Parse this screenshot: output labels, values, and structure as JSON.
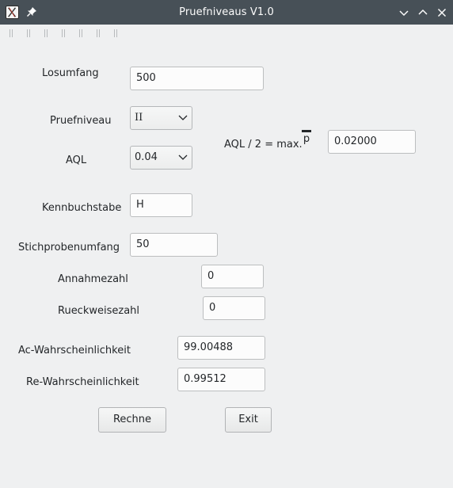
{
  "window": {
    "title": "Pruefniveaus V1.0",
    "app_icon": "app-icon",
    "pin_icon": "pin-icon",
    "controls": [
      "chevron-down-icon",
      "chevron-up-icon",
      "close-icon"
    ]
  },
  "form": {
    "losumfang": {
      "label": "Losumfang",
      "value": "500"
    },
    "pruefniveau": {
      "label": "Pruefniveau",
      "selected": "II"
    },
    "aql": {
      "label": "AQL",
      "selected": "0.04"
    },
    "aql_max": {
      "label": "AQL / 2 = max.",
      "p_symbol": "p",
      "value": "0.02000"
    },
    "kennbuchstabe": {
      "label": "Kennbuchstabe",
      "value": "H"
    },
    "stichprobenumfang": {
      "label": "Stichprobenumfang",
      "value": "50"
    },
    "annahmezahl": {
      "label": "Annahmezahl",
      "value": "0"
    },
    "rueckweisezahl": {
      "label": "Rueckweisezahl",
      "value": "0"
    },
    "ac_wahrscheinlichkeit": {
      "label": "Ac-Wahrscheinlichkeit",
      "value": "99.00488"
    },
    "re_wahrscheinlichkeit": {
      "label": "Re-Wahrscheinlichkeit",
      "value": "0.99512"
    }
  },
  "buttons": {
    "rechne": "Rechne",
    "exit": "Exit"
  }
}
